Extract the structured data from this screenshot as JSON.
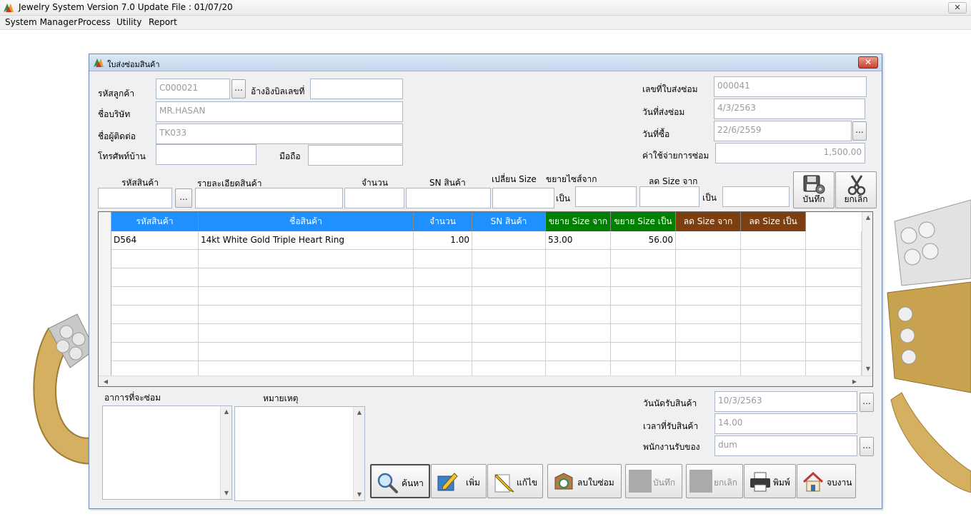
{
  "app": {
    "title": "Jewelry System Version 7.0 Update File : 01/07/20",
    "close_glyph": "✕",
    "menu": [
      "System Manager",
      "Process",
      "Utility",
      "Report"
    ]
  },
  "dialog": {
    "title": "ใบส่งซ่อมสินค้า",
    "close_glyph": "✕",
    "header": {
      "customer_code_label": "รหัสลูกค้า",
      "customer_code": "C000021",
      "ref_bill_label": "อ้างอิงบิลเลขที่",
      "ref_bill": "",
      "company_label": "ชื่อบริษัท",
      "company": "MR.HASAN",
      "contact_label": "ชื่อผู้ติดต่อ",
      "contact": "TK033",
      "home_phone_label": "โทรศัพท์บ้าน",
      "home_phone": "",
      "mobile_label": "มือถือ",
      "mobile": "",
      "repair_no_label": "เลขที่ใบส่งซ่อม",
      "repair_no": "000041",
      "repair_date_label": "วันที่ส่งซ่อม",
      "repair_date": "4/3/2563",
      "purchase_date_label": "วันที่ซื้อ",
      "purchase_date": "22/6/2559",
      "repair_cost_label": "ค่าใช้จ่ายการซ่อม",
      "repair_cost": "1,500.00",
      "ellipsis": "..."
    },
    "entry": {
      "product_code_label": "รหัสสินค้า",
      "product_detail_label": "รายละเอียดสินค้า",
      "qty_label": "จำนวน",
      "sn_label": "SN สินค้า",
      "change_size_label": "เปลี่ยน Size",
      "enlarge_from_label": "ขยายไซส์จาก",
      "to_label_1": "เป็น",
      "reduce_from_label": "ลด Size จาก",
      "to_label_2": "เป็น",
      "save_label": "บันทึก",
      "cancel_label": "ยกเลิก"
    },
    "grid": {
      "columns": [
        {
          "label": "รหัสสินค้า",
          "color": "#1e90ff"
        },
        {
          "label": "ชื่อสินค้า",
          "color": "#1e90ff"
        },
        {
          "label": "จำนวน",
          "color": "#1e90ff"
        },
        {
          "label": "SN สินค้า",
          "color": "#1e90ff"
        },
        {
          "label": "ขยาย Size จาก",
          "color": "#008000"
        },
        {
          "label": "ขยาย Size เป็น",
          "color": "#008000"
        },
        {
          "label": "ลด Size จาก",
          "color": "#7b3f12"
        },
        {
          "label": "ลด Size เป็น",
          "color": "#7b3f12"
        }
      ],
      "rows": [
        [
          "D564",
          "14kt White Gold Triple Heart Ring",
          "1.00",
          "",
          "53.00",
          "56.00",
          "",
          ""
        ]
      ]
    },
    "bottom": {
      "symptom_label": "อาการที่จะซ่อม",
      "note_label": "หมายเหตุ",
      "appointment_date_label": "วันนัดรับสินค้า",
      "appointment_date": "10/3/2563",
      "receive_time_label": "เวลาที่รับสินค้า",
      "receive_time": "14.00",
      "staff_label": "พนักงานรับของ",
      "staff": "dum"
    },
    "buttons": {
      "search": "ค้นหา",
      "add": "เพิ่ม",
      "edit": "แก้ไข",
      "delete": "ลบใบซ่อม",
      "save": "บันทึก",
      "cancel": "ยกเลิก",
      "print": "พิมพ์",
      "exit": "จบงาน"
    }
  }
}
